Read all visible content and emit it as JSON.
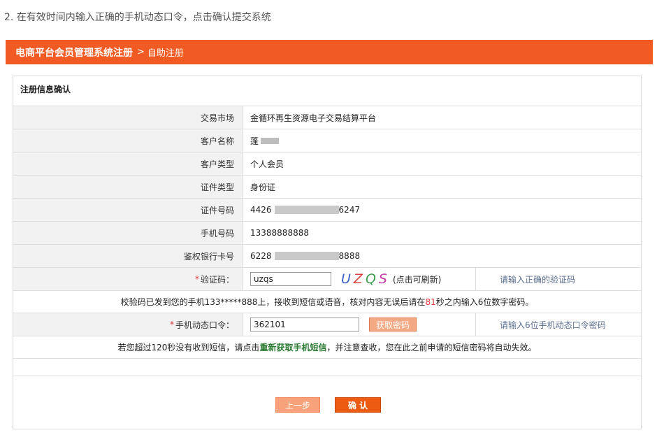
{
  "step_text": "2. 在有效时间内输入正确的手机动态口令，点击确认提交系统",
  "banner": {
    "main": "电商平台会员管理系统注册",
    "separator": ">",
    "sub": "自助注册"
  },
  "panel_title": "注册信息确认",
  "fields": {
    "market": {
      "label": "交易市场",
      "value": "金循环再生资源电子交易结算平台"
    },
    "customer_name": {
      "label": "客户名称",
      "value": "蓬"
    },
    "customer_type": {
      "label": "客户类型",
      "value": "个人会员"
    },
    "id_type": {
      "label": "证件类型",
      "value": "身份证"
    },
    "id_number": {
      "label": "证件号码",
      "prefix": "4426",
      "suffix": "6247"
    },
    "phone": {
      "label": "手机号码",
      "value": "13388888888"
    },
    "bank_card": {
      "label": "鉴权银行卡号",
      "prefix": "6228",
      "suffix": "8888"
    }
  },
  "captcha": {
    "required_mark": "*",
    "label": "验证码：",
    "value": "uzqs",
    "image_text": [
      "U",
      "Z",
      "Q",
      "S"
    ],
    "refresh_text": "(点击可刷新)",
    "hint": "请输入正确的验证码"
  },
  "sms_notice": {
    "part1": "校验码已发到您的手机133*****888上，接收到短信或语音，核对内容无误后请在",
    "seconds": "81",
    "part2": " 秒之内输入6位数字密码。"
  },
  "dynamic_code": {
    "required_mark": "*",
    "label": "手机动态口令：",
    "value": "362101",
    "get_button": "获取密码",
    "hint": "请输入6位手机动态口令密码"
  },
  "resend_notice": {
    "part1": "若您超过120秒没有收到短信，请点击",
    "link": "重新获取手机短信",
    "part2": "，并注意查收，您在此之前申请的短信密码将自动失效。"
  },
  "buttons": {
    "prev": "上一步",
    "confirm": "确 认"
  },
  "colors": {
    "accent": "#f15a22",
    "confirm_button": "#ed5a12",
    "prev_button": "#f7a27b",
    "hint_text": "#5a6e8c",
    "countdown": "#e4393c",
    "resend_link": "#2a7a32"
  }
}
